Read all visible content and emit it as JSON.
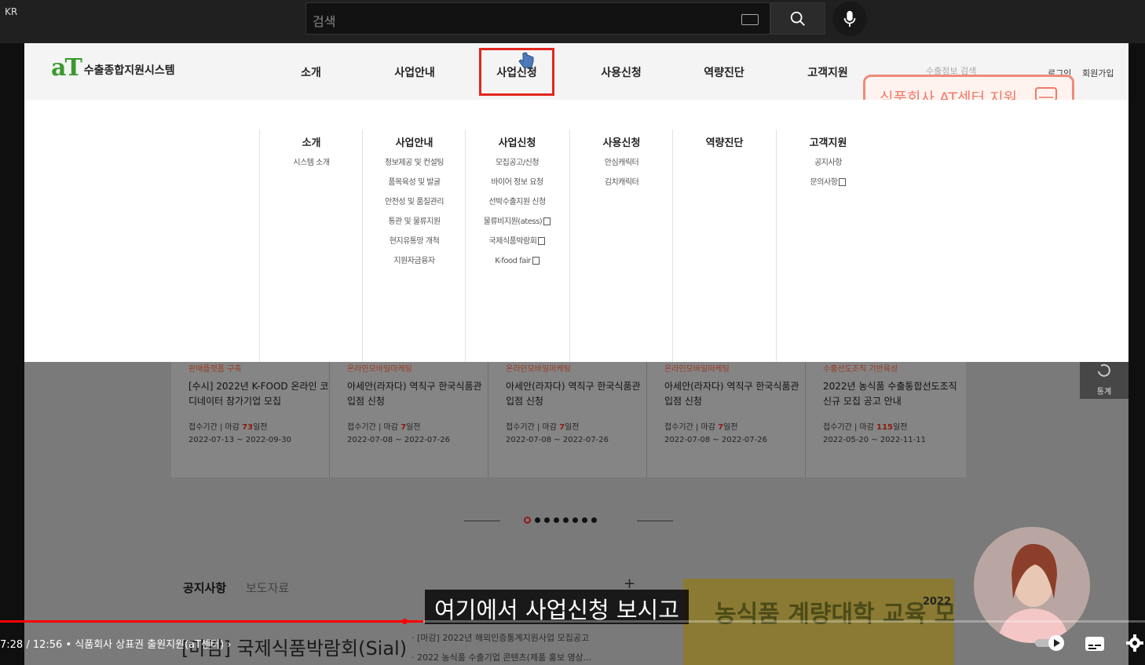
{
  "youtube": {
    "region": "KR",
    "search_placeholder": "검색",
    "time_current": "7:28",
    "time_total": "12:56",
    "video_title": "식품회사 상표권 출원지원(aT센터)",
    "progress": 0.37,
    "caption": "여기에서 사업신청 보시고"
  },
  "site": {
    "logo_mark": "aT",
    "logo_text": "수출종합지원시스템",
    "gnb": [
      "소개",
      "사업안내",
      "사업신청",
      "사용신청",
      "역량진단",
      "고객지원"
    ],
    "search_hint": "수출정보 검색",
    "login": "로그인",
    "signup": "회원가입",
    "callout": "식품회사 AT센터 지원",
    "menu": [
      {
        "title": "소개",
        "links": [
          "시스템 소개"
        ]
      },
      {
        "title": "사업안내",
        "links": [
          "정보제공 및 컨설팅",
          "품목육성 및 발굴",
          "안전성 및 품질관리",
          "통관 및 물류지원",
          "현지유통망 개척",
          "지원자금융자"
        ]
      },
      {
        "title": "사업신청",
        "links": [
          "모집공고/신청",
          "바이어 정보 요청",
          "선박수출지원 신청",
          "물류비지원(atess)",
          "국제식품박람회",
          "K-food fair"
        ]
      },
      {
        "title": "사용신청",
        "links": [
          "안심캐릭터",
          "김치캐릭터"
        ]
      },
      {
        "title": "역량진단",
        "links": []
      },
      {
        "title": "고객지원",
        "links": [
          "공지사항",
          "문의사항"
        ]
      }
    ],
    "cards": [
      {
        "cat": "판매플랫폼 구축",
        "title": "[수시] 2022년 K-FOOD 온라인 코디네이터 참가기업 모집",
        "meta_label": "접수기간",
        "deadline_prefix": "마감",
        "days": "73",
        "days_suffix": "일전",
        "dates": "2022-07-13 ~ 2022-09-30"
      },
      {
        "cat": "온라인모바일마케팅",
        "title": "아세안(라자다) 역직구 한국식품관 입점 신청",
        "meta_label": "접수기간",
        "deadline_prefix": "마감",
        "days": "7",
        "days_suffix": "일전",
        "dates": "2022-07-08 ~ 2022-07-26"
      },
      {
        "cat": "온라인모바일마케팅",
        "title": "아세안(라자다) 역직구 한국식품관 입점 신청",
        "meta_label": "접수기간",
        "deadline_prefix": "마감",
        "days": "7",
        "days_suffix": "일전",
        "dates": "2022-07-08 ~ 2022-07-26"
      },
      {
        "cat": "온라인모바일마케팅",
        "title": "아세안(라자다) 역직구 한국식품관 입점 신청",
        "meta_label": "접수기간",
        "deadline_prefix": "마감",
        "days": "7",
        "days_suffix": "일전",
        "dates": "2022-07-08 ~ 2022-07-26"
      },
      {
        "cat": "수출선도조직 기반육성",
        "title": "2022년 농식품 수출통합선도조직 신규 모집 공고 안내",
        "meta_label": "접수기간",
        "deadline_prefix": "마감",
        "days": "115",
        "days_suffix": "일전",
        "dates": "2022-05-20 ~ 2022-11-11"
      }
    ],
    "stat_label": "통계",
    "notice_tab": "공지사항",
    "news_tab": "보도자료",
    "notice_big": "[마감] 국제식품박람회(Sial)",
    "news_lines": [
      "· [마감] 2022년 해외인증통계지원사업 모집공고",
      "· 2022 농식품 수출기업 콘텐츠(제품 홍보 영상..."
    ],
    "banner_text": "농식품 계량대학 교육 모집 안내",
    "banner_year": "2022"
  },
  "colors": {
    "accent": "#e3261d",
    "callout": "#f07a66",
    "logo_green": "#3a9a2e",
    "progress": "#ff0000"
  }
}
